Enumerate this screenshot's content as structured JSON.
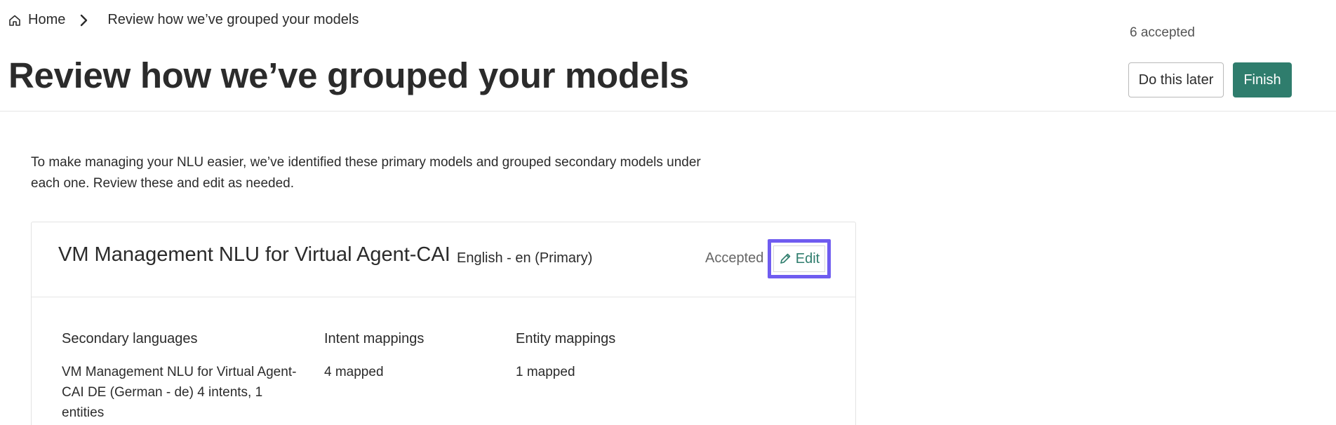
{
  "breadcrumb": {
    "home_label": "Home",
    "current_label": "Review how we’ve grouped your models"
  },
  "header": {
    "accepted_count": "6 accepted",
    "title": "Review how we’ve grouped your models",
    "do_later_label": "Do this later",
    "finish_label": "Finish"
  },
  "intro_text": "To make managing your NLU easier, we’ve identified these primary models and grouped secondary models under each one. Review these and edit as needed.",
  "model_card": {
    "name": "VM Management NLU for Virtual Agent-CAI",
    "language": "English - en (Primary)",
    "status": "Accepted",
    "edit_label": "Edit",
    "columns": [
      {
        "heading": "Secondary languages",
        "value": "VM Management NLU for Virtual Agent-CAI DE (German - de) 4 intents, 1 entities"
      },
      {
        "heading": "Intent mappings",
        "value": "4 mapped"
      },
      {
        "heading": "Entity mappings",
        "value": "1 mapped"
      }
    ]
  },
  "colors": {
    "primary_button": "#2f7d6d",
    "edit_link": "#2f7d6d",
    "focus_highlight": "#6f5cf0"
  },
  "icons": {
    "home": "home-icon",
    "breadcrumb_separator": "chevron-right-icon",
    "edit": "pencil-icon"
  }
}
